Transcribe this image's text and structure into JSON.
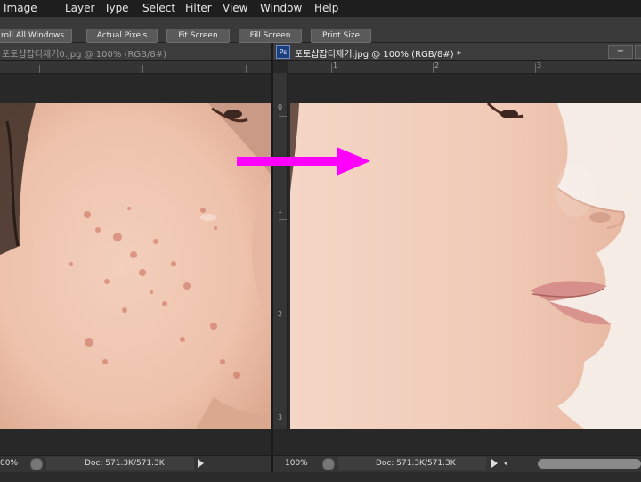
{
  "menu": [
    "Image",
    "Layer",
    "Type",
    "Select",
    "Filter",
    "View",
    "Window",
    "Help"
  ],
  "options_bar": {
    "scroll_all": "roll All Windows",
    "actual_pixels": "Actual Pixels",
    "fit_screen": "Fit Screen",
    "fill_screen": "Fill Screen",
    "print_size": "Print Size"
  },
  "left_doc": {
    "tab_title": "포토샵잡티제거0.jpg @ 100% (RGB/8#)",
    "zoom": "00%",
    "doc_info": "Doc: 571.3K/571.3K"
  },
  "right_doc": {
    "ps_badge": "Ps",
    "tab_title": "포토샵잡티제거.jpg @ 100% (RGB/8#) *",
    "zoom": "100%",
    "doc_info": "Doc: 571.3K/571.3K",
    "minimize": "−",
    "ruler_h": [
      "1",
      "2",
      "3"
    ],
    "ruler_v": [
      "0",
      "1",
      "2",
      "3"
    ]
  },
  "colors": {
    "arrow": "#ff00ff",
    "ps_badge": "#1c3f7a"
  }
}
